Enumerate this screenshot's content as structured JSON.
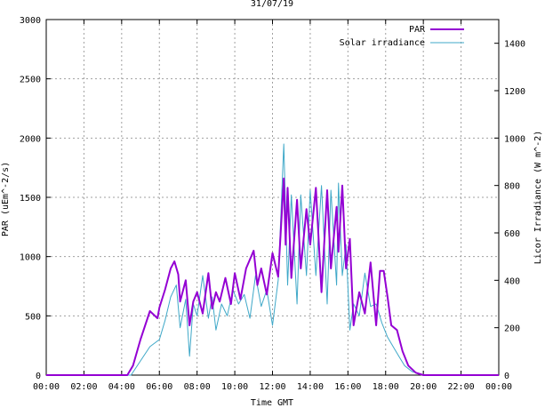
{
  "chart_data": {
    "type": "line",
    "title": "31/07/19",
    "xlabel": "Time GMT",
    "ylabel_left": "PAR (uEm^-2/s)",
    "ylabel_right": "Licor Irradiance (W m^-2)",
    "x_ticks": [
      "00:00",
      "02:00",
      "04:00",
      "06:00",
      "08:00",
      "10:00",
      "12:00",
      "14:00",
      "16:00",
      "18:00",
      "20:00",
      "22:00",
      "00:00"
    ],
    "x_range_hours": [
      0,
      24
    ],
    "ylim_left": [
      0,
      3000
    ],
    "yticks_left": [
      "0",
      "500",
      "1000",
      "1500",
      "2000",
      "2500",
      "3000"
    ],
    "ylim_right": [
      0,
      1500
    ],
    "yticks_right": [
      "0",
      "200",
      "400",
      "600",
      "800",
      "1000",
      "1200",
      "1400"
    ],
    "grid": true,
    "legend_position": "top-right",
    "series": [
      {
        "name": "PAR",
        "color": "#9400d3",
        "axis": "left",
        "x": [
          0,
          4.3,
          4.6,
          5,
          5.5,
          5.9,
          6.0,
          6.3,
          6.6,
          6.8,
          7.0,
          7.1,
          7.4,
          7.6,
          7.8,
          8.0,
          8.3,
          8.6,
          8.8,
          9.0,
          9.2,
          9.5,
          9.8,
          10.0,
          10.3,
          10.6,
          11.0,
          11.2,
          11.4,
          11.7,
          12.0,
          12.3,
          12.6,
          12.7,
          12.8,
          13.0,
          13.3,
          13.5,
          13.8,
          14.0,
          14.3,
          14.6,
          14.9,
          15.1,
          15.4,
          15.5,
          15.7,
          15.9,
          16.1,
          16.3,
          16.6,
          16.9,
          17.2,
          17.5,
          17.7,
          17.9,
          18.1,
          18.3,
          18.6,
          18.9,
          19.2,
          19.6,
          20.0,
          20.2,
          24
        ],
        "y": [
          0,
          0,
          80,
          300,
          540,
          480,
          570,
          720,
          900,
          960,
          850,
          620,
          800,
          420,
          620,
          700,
          520,
          860,
          560,
          700,
          620,
          820,
          600,
          860,
          640,
          900,
          1050,
          760,
          900,
          680,
          1030,
          830,
          1660,
          1100,
          1580,
          820,
          1480,
          900,
          1400,
          1100,
          1580,
          700,
          1560,
          900,
          1420,
          1040,
          1600,
          900,
          1150,
          420,
          700,
          520,
          950,
          420,
          880,
          880,
          660,
          420,
          380,
          200,
          80,
          20,
          0,
          0,
          0
        ]
      },
      {
        "name": "Solar irradiance",
        "color": "#3fa8c8",
        "axis": "right",
        "x": [
          0,
          4.5,
          5,
          5.5,
          6.0,
          6.3,
          6.6,
          6.9,
          7.1,
          7.4,
          7.6,
          7.8,
          8.0,
          8.3,
          8.6,
          8.8,
          9.0,
          9.3,
          9.6,
          9.9,
          10.2,
          10.5,
          10.8,
          11.1,
          11.4,
          11.7,
          12.0,
          12.3,
          12.6,
          12.8,
          13.0,
          13.3,
          13.5,
          13.8,
          14.0,
          14.3,
          14.6,
          14.9,
          15.1,
          15.4,
          15.5,
          15.7,
          15.9,
          16.1,
          16.3,
          16.6,
          16.9,
          17.2,
          17.5,
          17.8,
          18.1,
          18.4,
          18.7,
          19.0,
          19.4,
          19.8,
          20.2,
          24
        ],
        "y": [
          0,
          0,
          60,
          120,
          150,
          230,
          330,
          380,
          200,
          320,
          80,
          300,
          250,
          420,
          240,
          330,
          190,
          300,
          250,
          360,
          300,
          340,
          240,
          420,
          290,
          360,
          210,
          400,
          975,
          380,
          760,
          300,
          760,
          420,
          780,
          420,
          800,
          300,
          780,
          380,
          810,
          420,
          550,
          190,
          300,
          250,
          430,
          290,
          300,
          220,
          160,
          120,
          80,
          40,
          15,
          5,
          0,
          0
        ]
      }
    ]
  }
}
